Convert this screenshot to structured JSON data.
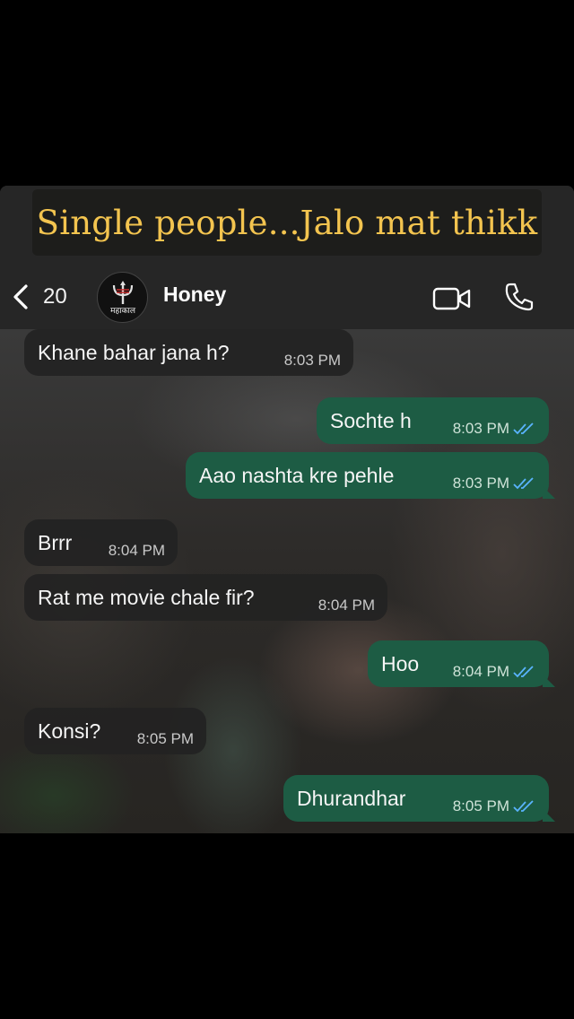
{
  "caption": "Single people...Jalo mat thikk",
  "header": {
    "back_count": "20",
    "avatar_text": "महाकाल",
    "contact_name": "Honey"
  },
  "colors": {
    "caption_text": "#f3c44f",
    "outgoing_bubble": "#1d5c44",
    "incoming_bubble": "#222222",
    "read_ticks": "#5ab4ff"
  },
  "messages": [
    {
      "direction": "in",
      "text": "Khane bahar jana h?",
      "time": "8:03 PM"
    },
    {
      "direction": "out",
      "text": "Sochte h",
      "time": "8:03 PM",
      "status": "read"
    },
    {
      "direction": "out",
      "text": "Aao nashta kre pehle",
      "time": "8:03 PM",
      "status": "read"
    },
    {
      "direction": "in",
      "text": "Brrr",
      "time": "8:04 PM"
    },
    {
      "direction": "in",
      "text": "Rat me movie chale fir?",
      "time": "8:04 PM"
    },
    {
      "direction": "out",
      "text": "Hoo",
      "time": "8:04 PM",
      "status": "read"
    },
    {
      "direction": "in",
      "text": "Konsi?",
      "time": "8:05 PM"
    },
    {
      "direction": "out",
      "text": "Dhurandhar",
      "time": "8:05 PM",
      "status": "read"
    }
  ]
}
